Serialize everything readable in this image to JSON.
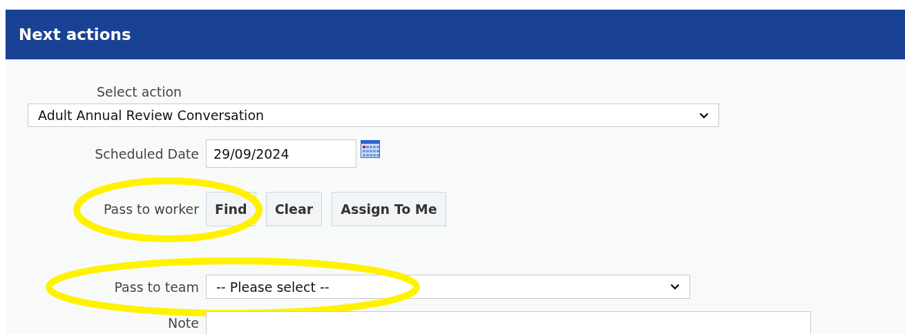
{
  "panel": {
    "title": "Next actions"
  },
  "select_action": {
    "label": "Select action",
    "value": "Adult Annual Review Conversation"
  },
  "scheduled_date": {
    "label": "Scheduled Date",
    "value": "29/09/2024"
  },
  "pass_to_worker": {
    "label": "Pass to worker",
    "highlighted": true,
    "buttons": [
      "Find",
      "Clear",
      "Assign To Me"
    ]
  },
  "pass_to_team": {
    "label": "Pass to team",
    "value": "-- Please select --",
    "highlighted": true
  },
  "note": {
    "label": "Note"
  }
}
